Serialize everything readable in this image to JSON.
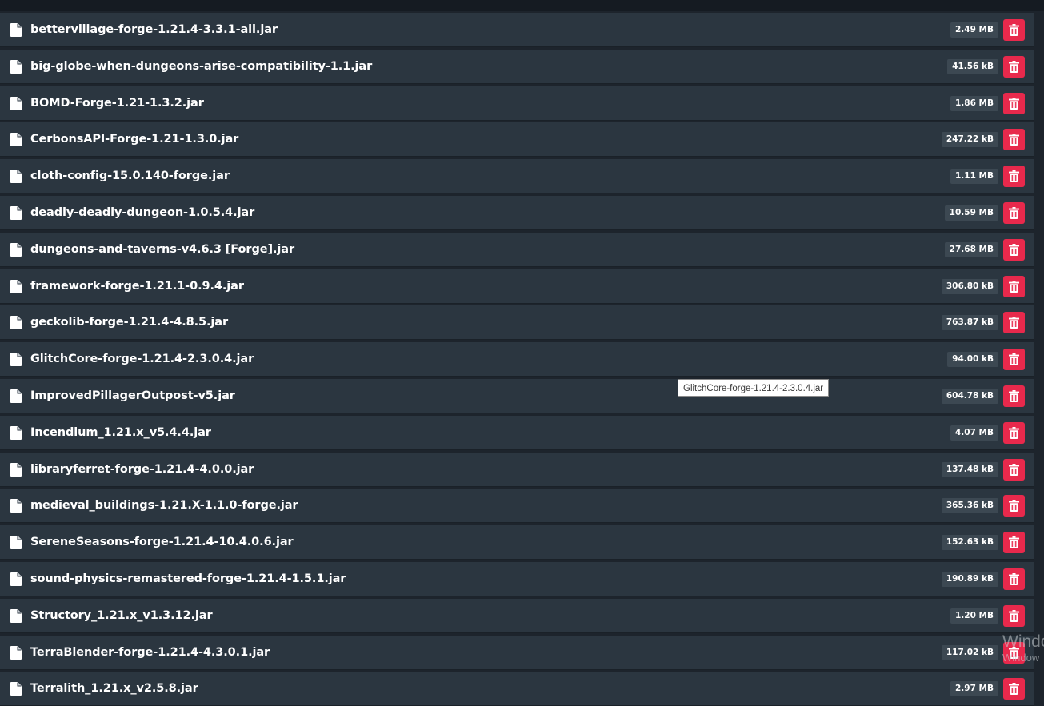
{
  "colors": {
    "row_background": "#2b3640",
    "size_badge": "#3c4852",
    "delete_button": "#e8294c",
    "text": "#ffffff"
  },
  "icons": {
    "file": "file-icon",
    "delete": "trash-icon"
  },
  "files": [
    {
      "name": "bettervillage-forge-1.21.4-3.3.1-all.jar",
      "size": "2.49 MB"
    },
    {
      "name": "big-globe-when-dungeons-arise-compatibility-1.1.jar",
      "size": "41.56 kB"
    },
    {
      "name": "BOMD-Forge-1.21-1.3.2.jar",
      "size": "1.86 MB"
    },
    {
      "name": "CerbonsAPI-Forge-1.21-1.3.0.jar",
      "size": "247.22 kB"
    },
    {
      "name": "cloth-config-15.0.140-forge.jar",
      "size": "1.11 MB"
    },
    {
      "name": "deadly-deadly-dungeon-1.0.5.4.jar",
      "size": "10.59 MB"
    },
    {
      "name": "dungeons-and-taverns-v4.6.3 [Forge].jar",
      "size": "27.68 MB"
    },
    {
      "name": "framework-forge-1.21.1-0.9.4.jar",
      "size": "306.80 kB"
    },
    {
      "name": "geckolib-forge-1.21.4-4.8.5.jar",
      "size": "763.87 kB"
    },
    {
      "name": "GlitchCore-forge-1.21.4-2.3.0.4.jar",
      "size": "94.00 kB"
    },
    {
      "name": "ImprovedPillagerOutpost-v5.jar",
      "size": "604.78 kB"
    },
    {
      "name": "Incendium_1.21.x_v5.4.4.jar",
      "size": "4.07 MB"
    },
    {
      "name": "libraryferret-forge-1.21.4-4.0.0.jar",
      "size": "137.48 kB"
    },
    {
      "name": "medieval_buildings-1.21.X-1.1.0-forge.jar",
      "size": "365.36 kB"
    },
    {
      "name": "SereneSeasons-forge-1.21.4-10.4.0.6.jar",
      "size": "152.63 kB"
    },
    {
      "name": "sound-physics-remastered-forge-1.21.4-1.5.1.jar",
      "size": "190.89 kB"
    },
    {
      "name": "Structory_1.21.x_v1.3.12.jar",
      "size": "1.20 MB"
    },
    {
      "name": "TerraBlender-forge-1.21.4-4.3.0.1.jar",
      "size": "117.02 kB"
    },
    {
      "name": "Terralith_1.21.x_v2.5.8.jar",
      "size": "2.97 MB"
    }
  ],
  "tooltip": {
    "text": "GlitchCore-forge-1.21.4-2.3.0.4.jar"
  },
  "watermark": {
    "line1": "Windo",
    "line2": "Window"
  }
}
